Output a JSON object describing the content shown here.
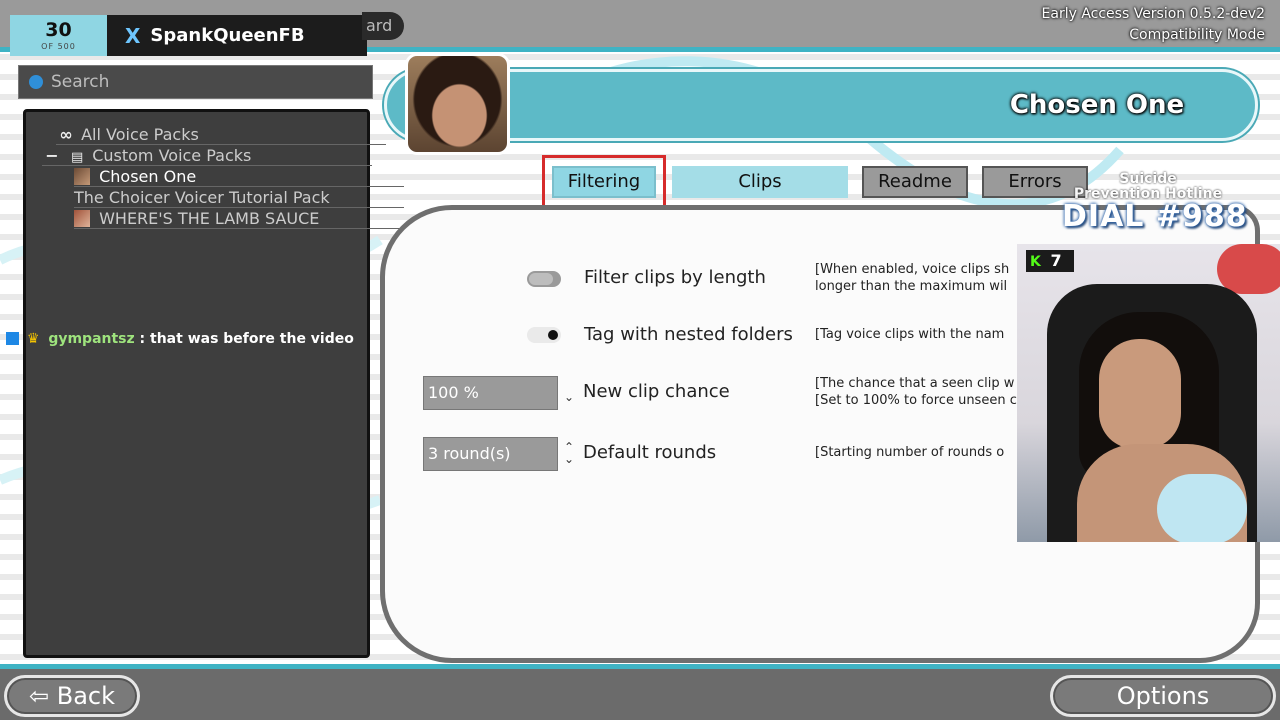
{
  "top_bar": {
    "counter_value": "30",
    "counter_sub": "OF 500",
    "social_icon": "X",
    "social_handle": "SpankQueenFB",
    "tail_text": "ard",
    "version_line1": "Early Access Version 0.5.2-dev2",
    "version_line2": "Compatibility Mode"
  },
  "sidebar": {
    "search_placeholder": "Search",
    "tree": [
      {
        "symbol": "∞",
        "label": "All Voice Packs"
      },
      {
        "symbol": "−",
        "label": "Custom Voice Packs"
      },
      {
        "label": "Chosen One"
      },
      {
        "label": "The Choicer Voicer Tutorial Pack"
      },
      {
        "label": "WHERE'S THE LAMB SAUCE"
      }
    ]
  },
  "chat": {
    "user": "gympantsz",
    "message": ": that was before the video"
  },
  "header": {
    "title": "Chosen One"
  },
  "tabs": {
    "filtering": "Filtering",
    "clips": "Clips",
    "readme": "Readme",
    "errors": "Errors"
  },
  "settings": {
    "filter_length": {
      "label": "Filter clips by length",
      "enabled": false,
      "desc_line1": "[When enabled, voice clips sh",
      "desc_line2": "longer than the maximum wil"
    },
    "nested_folders": {
      "label": "Tag with nested folders",
      "enabled": true,
      "desc": "[Tag voice clips with the nam"
    },
    "new_clip_chance": {
      "label": "New clip chance",
      "value": "100 %",
      "desc_line1": "[The chance that a seen clip w",
      "desc_line2": "[Set to 100% to force unseen c"
    },
    "default_rounds": {
      "label": "Default rounds",
      "value": "3 round(s)",
      "desc": "[Starting number of rounds o"
    }
  },
  "overlay": {
    "kick_count": "7",
    "hotline_small_1": "Suicide",
    "hotline_small_2": "Prevention Hotline",
    "hotline_big": "DIAL #988"
  },
  "bottom_bar": {
    "back_label": "Back",
    "options_label": "Options"
  },
  "colors": {
    "accent_teal": "#5dbac7",
    "active_tab": "#8fd6e3",
    "focus_red": "#d62b2b",
    "panel_gray": "#3e3e3e"
  }
}
